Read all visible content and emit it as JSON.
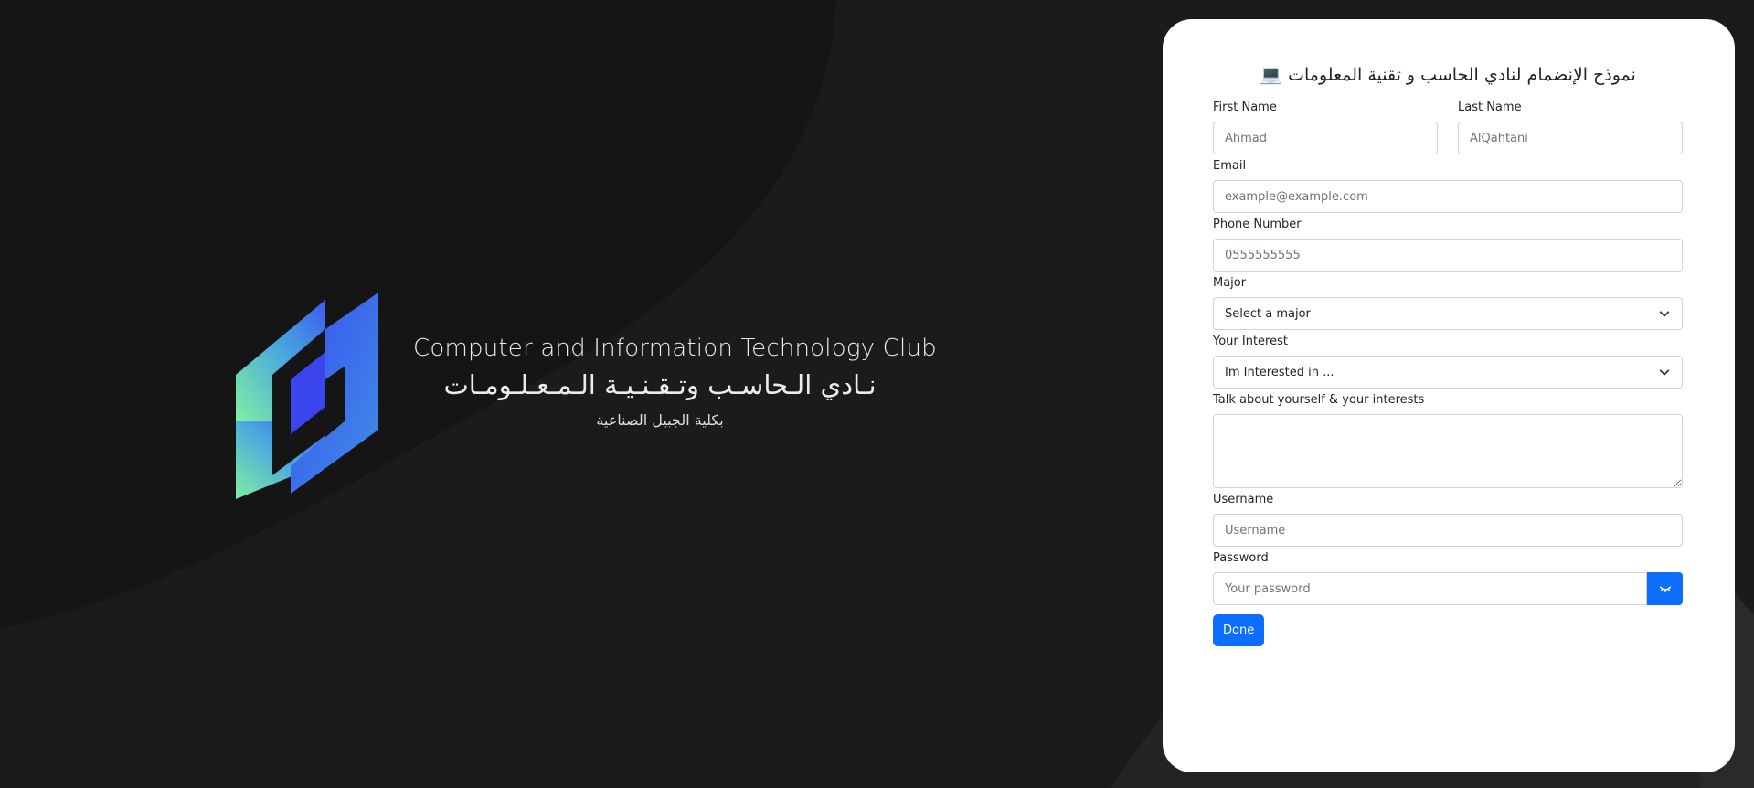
{
  "brand": {
    "title_en": "Computer and Information Technology Club",
    "title_ar": "نـادي الـحاسـب وتـقـنـيـة الـمـعـلـومـات",
    "subtitle_ar": "بكلية الجبيل الصناعية",
    "logo_icon": "club-logo-icon"
  },
  "form": {
    "title": "نموذج الإنضمام لنادي الحاسب و تقنية المعلومات",
    "title_emoji": "💻",
    "first_name": {
      "label": "First Name",
      "placeholder": "Ahmad",
      "value": ""
    },
    "last_name": {
      "label": "Last Name",
      "placeholder": "AlQahtani",
      "value": ""
    },
    "email": {
      "label": "Email",
      "placeholder": "example@example.com",
      "value": ""
    },
    "phone": {
      "label": "Phone Number",
      "placeholder": "0555555555",
      "value": ""
    },
    "major": {
      "label": "Major",
      "selected": "Select a major",
      "icon": "chevron-down-icon"
    },
    "interest": {
      "label": "Your Interest",
      "selected": "Im Interested in ...",
      "icon": "chevron-down-icon"
    },
    "about": {
      "label": "Talk about yourself & your interests",
      "value": ""
    },
    "username": {
      "label": "Username",
      "placeholder": "Username",
      "value": ""
    },
    "password": {
      "label": "Password",
      "placeholder": "Your password",
      "value": "",
      "toggle_icon": "eye-closed-icon"
    },
    "submit_label": "Done"
  },
  "colors": {
    "background": "#1b1b1b",
    "card": "#ffffff",
    "accent": "#0d6efd",
    "logo_gradient_start": "#7ef0a0",
    "logo_gradient_end": "#3b5bf0"
  }
}
